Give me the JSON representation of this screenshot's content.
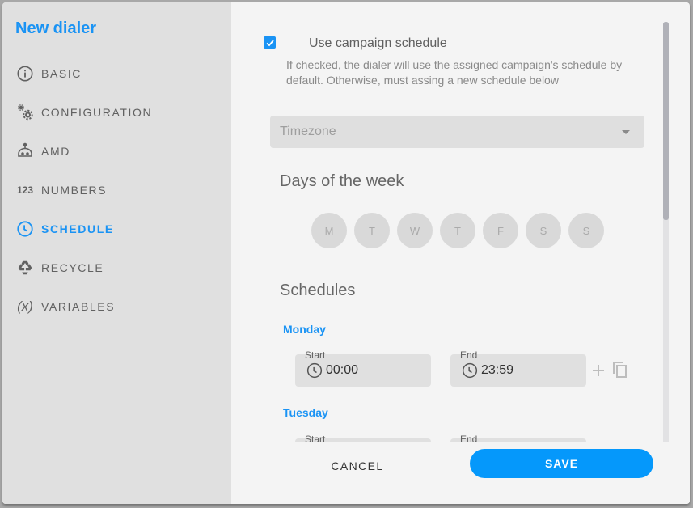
{
  "sidebar": {
    "title": "New dialer",
    "items": [
      {
        "label": "BASIC",
        "icon": "info-icon",
        "active": false
      },
      {
        "label": "CONFIGURATION",
        "icon": "gears-icon",
        "active": false
      },
      {
        "label": "AMD",
        "icon": "robot-icon",
        "active": false
      },
      {
        "label": "NUMBERS",
        "icon": "numbers-icon",
        "active": false
      },
      {
        "label": "SCHEDULE",
        "icon": "clock-icon",
        "active": true
      },
      {
        "label": "RECYCLE",
        "icon": "recycle-icon",
        "active": false
      },
      {
        "label": "VARIABLES",
        "icon": "variable-icon",
        "active": false
      }
    ],
    "numbers_glyph": "123",
    "variables_glyph": "(x)"
  },
  "main": {
    "use_campaign_schedule": {
      "label": "Use campaign schedule",
      "checked": true,
      "help": "If checked, the dialer will use the assigned campaign's schedule by default. Otherwise, must assing a new schedule below"
    },
    "timezone": {
      "placeholder": "Timezone"
    },
    "days_title": "Days of the week",
    "days": [
      "M",
      "T",
      "W",
      "T",
      "F",
      "S",
      "S"
    ],
    "schedules_title": "Schedules",
    "schedules": [
      {
        "day": "Monday",
        "start_label": "Start",
        "start": "00:00",
        "end_label": "End",
        "end": "23:59"
      },
      {
        "day": "Tuesday",
        "start_label": "Start",
        "start": "",
        "end_label": "End",
        "end": ""
      }
    ]
  },
  "footer": {
    "cancel_label": "CANCEL",
    "save_label": "SAVE"
  },
  "colors": {
    "accent": "#1a93f4",
    "save_button": "#0598fb"
  }
}
